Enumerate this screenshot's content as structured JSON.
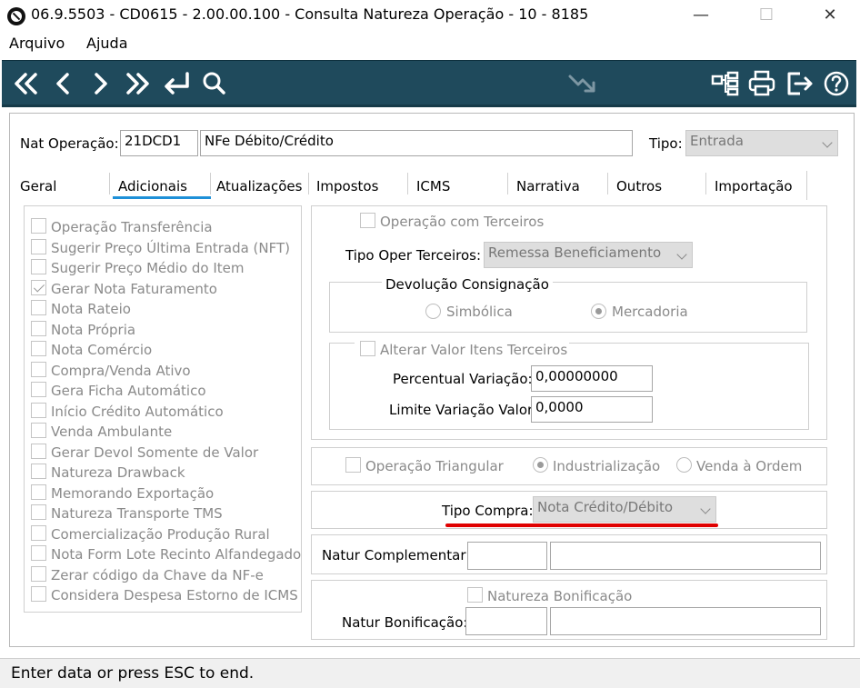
{
  "window": {
    "title": "06.9.5503 - CD0615 - 2.00.00.100 - Consulta Natureza Operação - 10 - 8185",
    "minimize": "—",
    "maximize": "☐",
    "close": "✕"
  },
  "menu": [
    "Arquivo",
    "Ajuda"
  ],
  "toolbar": {
    "icons": [
      "first-record-icon",
      "previous-record-icon",
      "next-record-icon",
      "last-record-icon",
      "enter-icon",
      "search-icon",
      "trend-icon",
      "tree-icon",
      "print-icon",
      "exit-icon",
      "help-icon"
    ]
  },
  "header": {
    "nat_label": "Nat Operação:",
    "nat_code": "21DCD1",
    "nat_desc": "NFe Débito/Crédito",
    "tipo_label": "Tipo:",
    "tipo_value": "Entrada"
  },
  "tabs": [
    "Geral",
    "Adicionais",
    "Atualizações",
    "Impostos",
    "ICMS",
    "Narrativa",
    "Outros",
    "Importação"
  ],
  "active_tab": "Adicionais",
  "left_checks": [
    {
      "label": "Operação Transferência",
      "checked": false
    },
    {
      "label": "Sugerir Preço Última Entrada (NFT)",
      "checked": false
    },
    {
      "label": "Sugerir Preço Médio do Item",
      "checked": false
    },
    {
      "label": "Gerar Nota Faturamento",
      "checked": true
    },
    {
      "label": "Nota Rateio",
      "checked": false
    },
    {
      "label": "Nota Própria",
      "checked": false
    },
    {
      "label": "Nota Comércio",
      "checked": false
    },
    {
      "label": "Compra/Venda Ativo",
      "checked": false
    },
    {
      "label": "Gera Ficha Automático",
      "checked": false
    },
    {
      "label": "Início Crédito Automático",
      "checked": false
    },
    {
      "label": "Venda Ambulante",
      "checked": false
    },
    {
      "label": "Gerar Devol Somente de Valor",
      "checked": false
    },
    {
      "label": "Natureza Drawback",
      "checked": false
    },
    {
      "label": "Memorando Exportação",
      "checked": false
    },
    {
      "label": "Natureza Transporte TMS",
      "checked": false
    },
    {
      "label": "Comercialização Produção Rural",
      "checked": false
    },
    {
      "label": "Nota Form Lote Recinto Alfandegado",
      "checked": false
    },
    {
      "label": "Zerar código da Chave da NF-e",
      "checked": false
    },
    {
      "label": "Considera Despesa Estorno de ICMS",
      "checked": false
    }
  ],
  "terceiros": {
    "op_label": "Operação com Terceiros",
    "tipo_label": "Tipo Oper Terceiros:",
    "tipo_value": "Remessa Beneficiamento",
    "devol_legend": "Devolução Consignação",
    "simbolica": "Simbólica",
    "mercadoria": "Mercadoria",
    "alterar_label": "Alterar Valor Itens Terceiros",
    "percentual_label": "Percentual Variação:",
    "percentual_value": "0,00000000",
    "limite_label": "Limite Variação Valor:",
    "limite_value": "0,0000"
  },
  "triangular": {
    "label": "Operação Triangular",
    "industrializacao": "Industrialização",
    "venda_ordem": "Venda à Ordem"
  },
  "compra": {
    "label": "Tipo Compra:",
    "value": "Nota Crédito/Débito",
    "underline_color": "#e00000"
  },
  "complementar": {
    "label": "Natur Complementar:"
  },
  "bonificacao": {
    "check_label": "Natureza Bonificação",
    "label": "Natur Bonificação:"
  },
  "status": {
    "text": "Enter data or press ESC to end."
  },
  "colors": {
    "toolbar": "#1f4a5c",
    "tab_active_underline": "#1e90d8"
  }
}
